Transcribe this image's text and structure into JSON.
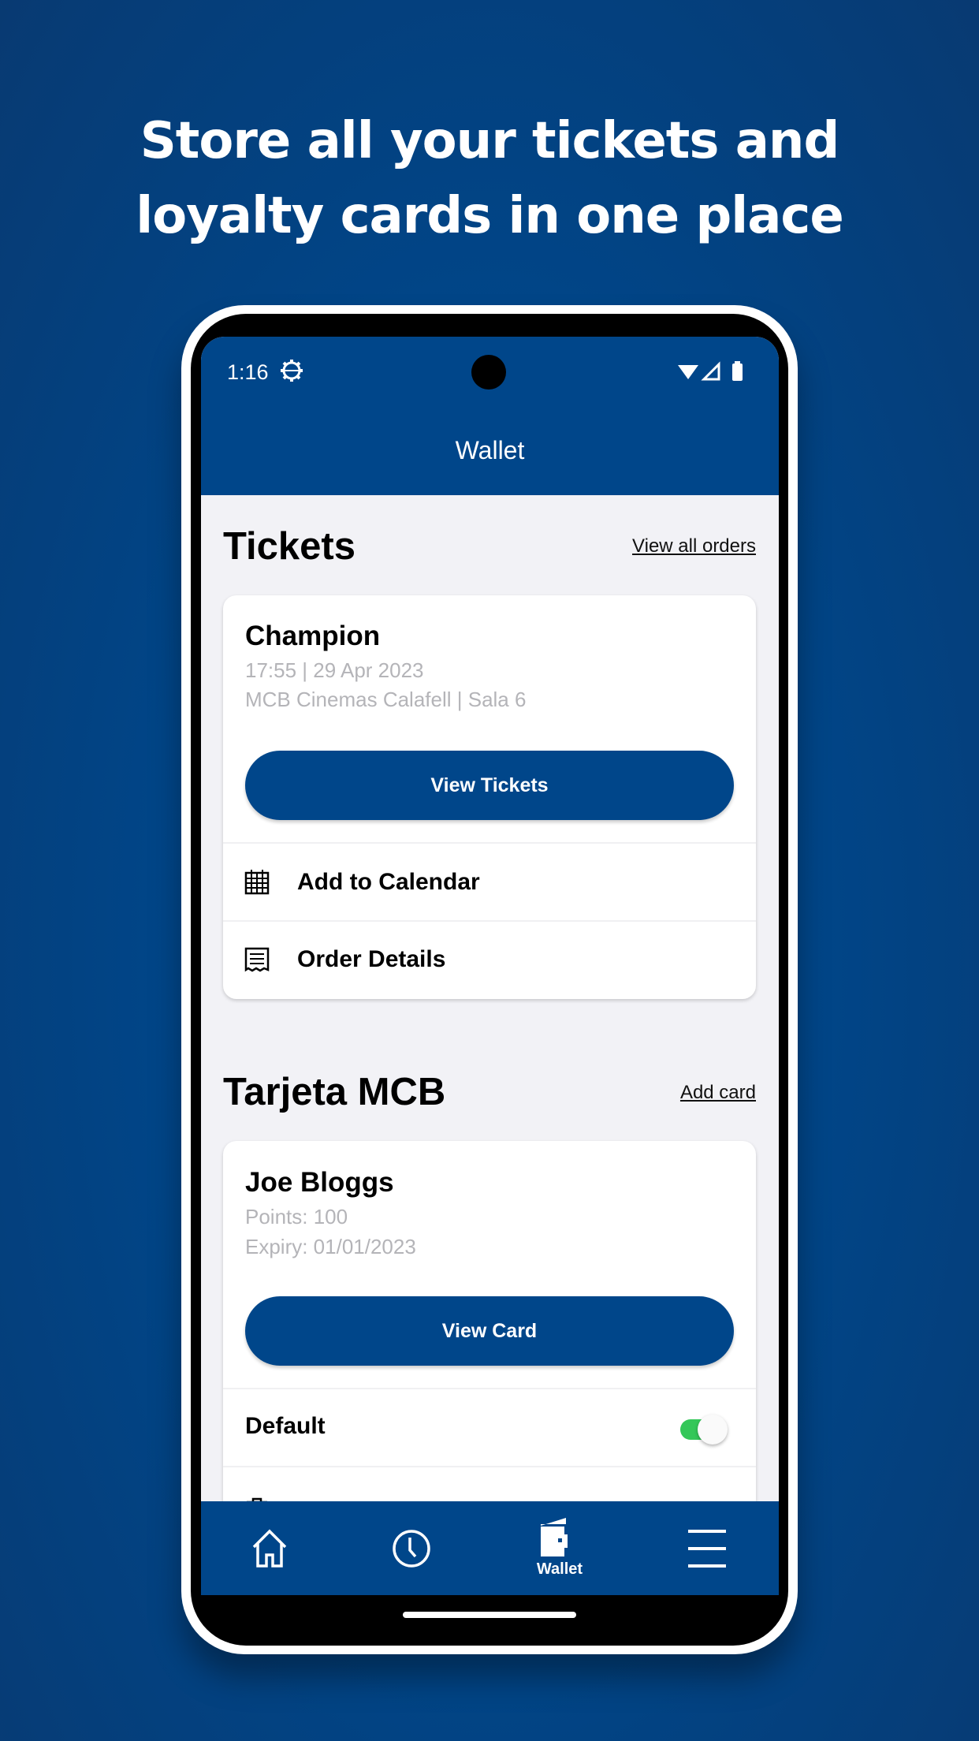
{
  "headline": {
    "line1": "Store all your tickets and",
    "line2": "loyalty cards in one place"
  },
  "status_bar": {
    "time": "1:16"
  },
  "app_bar": {
    "title": "Wallet"
  },
  "tickets": {
    "heading": "Tickets",
    "view_all_label": "View all orders",
    "card": {
      "title": "Champion",
      "datetime": "17:55 | 29 Apr 2023",
      "venue": "MCB Cinemas Calafell | Sala 6",
      "button_label": "View Tickets",
      "actions": [
        {
          "icon": "calendar-icon",
          "label": "Add to Calendar"
        },
        {
          "icon": "receipt-icon",
          "label": "Order Details"
        }
      ]
    }
  },
  "loyalty": {
    "heading": "Tarjeta MCB",
    "add_label": "Add card",
    "card": {
      "name": "Joe Bloggs",
      "points": "Points: 100",
      "expiry": "Expiry: 01/01/2023",
      "button_label": "View Card",
      "default_label": "Default",
      "default_on": true
    }
  },
  "bottom_nav": {
    "items": [
      {
        "icon": "home-icon",
        "label": ""
      },
      {
        "icon": "clock-icon",
        "label": ""
      },
      {
        "icon": "wallet-icon",
        "label": "Wallet",
        "active": true
      },
      {
        "icon": "menu-icon",
        "label": ""
      }
    ]
  },
  "colors": {
    "brand": "#00468a",
    "toggle_on": "#34c759",
    "background": "#f2f2f6"
  }
}
